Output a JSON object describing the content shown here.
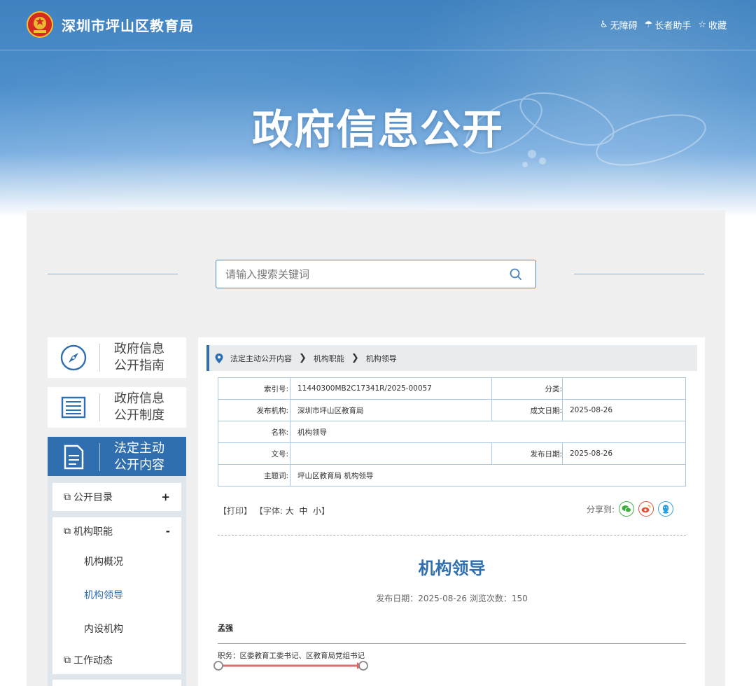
{
  "header": {
    "site_title": "深圳市坪山区教育局",
    "tools": [
      {
        "icon": "accessibility-icon",
        "glyph": "♿",
        "label": "无障碍"
      },
      {
        "icon": "elderly-helper-icon",
        "glyph": "☂",
        "label": "长者助手"
      },
      {
        "icon": "star-icon",
        "glyph": "☆",
        "label": "收藏"
      }
    ],
    "page_heading": "政府信息公开"
  },
  "search": {
    "placeholder": "请输入搜索关键词"
  },
  "sidebar": {
    "cards": [
      {
        "label_line1": "政府信息",
        "label_line2": "公开指南"
      },
      {
        "label_line1": "政府信息",
        "label_line2": "公开制度"
      },
      {
        "label_line1": "法定主动",
        "label_line2": "公开内容"
      }
    ],
    "groups": [
      {
        "label": "公开目录",
        "toggle": "+"
      },
      {
        "label": "机构职能",
        "toggle": "-",
        "items": [
          "机构概况",
          "机构领导",
          "内设机构"
        ]
      },
      {
        "label": "工作动态"
      }
    ]
  },
  "breadcrumb": [
    "法定主动公开内容",
    "机构职能",
    "机构领导"
  ],
  "meta": {
    "index_label": "索引号:",
    "index_value": "11440300MB2C17341R/2025-00057",
    "category_label": "分类:",
    "category_value": "",
    "publisher_label": "发布机构:",
    "publisher_value": "深圳市坪山区教育局",
    "written_label": "成文日期:",
    "written_value": "2025-08-26",
    "name_label": "名称:",
    "name_value": "机构领导",
    "docno_label": "文号:",
    "docno_value": "",
    "pubdate_label": "发布日期:",
    "pubdate_value": "2025-08-26",
    "subject_label": "主题词:",
    "subject_value": "坪山区教育局 机构领导"
  },
  "article_tools": {
    "print": "【打印】",
    "font_prefix": "【字体:",
    "font_large": "大",
    "font_medium": "中",
    "font_small": "小",
    "font_suffix": "】",
    "share_label": "分享到:"
  },
  "article": {
    "title": "机构领导",
    "meta_line": "发布日期：2025-08-26  浏览次数：150",
    "person_name": "孟强",
    "duty": "职务：区委教育工委书记、区教育局党组书记"
  },
  "colors": {
    "brand_blue": "#2f6fb0",
    "wechat": "#3fae3f",
    "weibo": "#e2523a",
    "qq": "#2e9fe0"
  }
}
